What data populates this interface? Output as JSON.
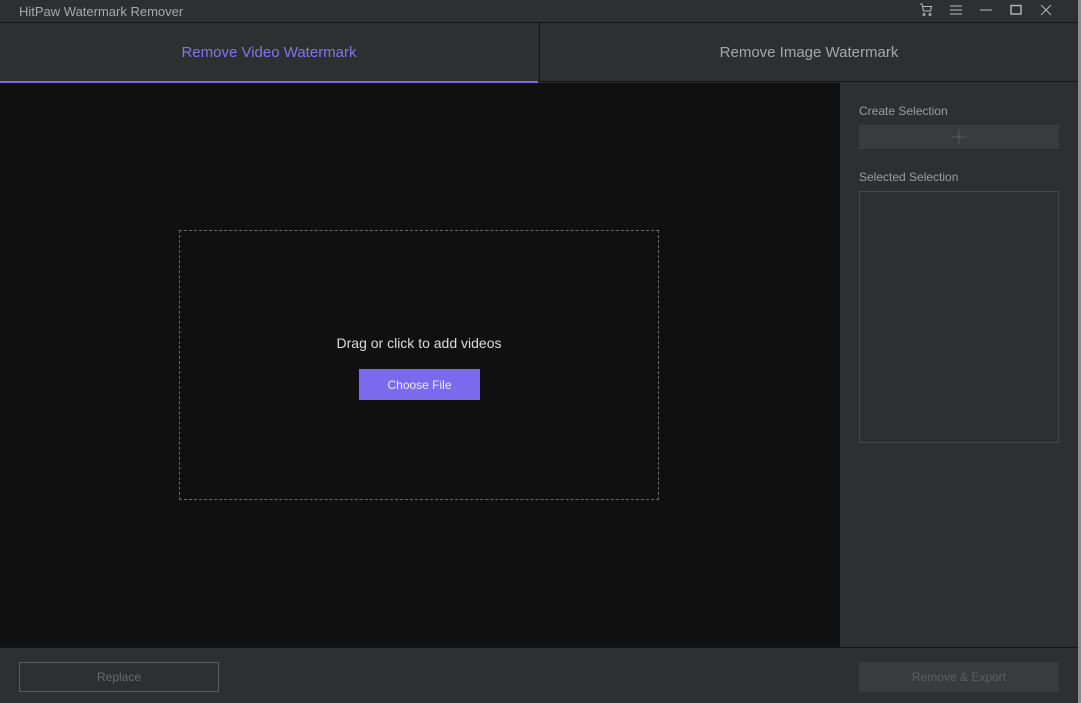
{
  "window": {
    "title": "HitPaw Watermark Remover",
    "controls": [
      {
        "name": "cart-icon",
        "label": "Store"
      },
      {
        "name": "menu-icon",
        "label": "Menu"
      },
      {
        "name": "minimize-icon",
        "label": "Minimize"
      },
      {
        "name": "maximize-icon",
        "label": "Maximize"
      },
      {
        "name": "close-icon",
        "label": "Close"
      }
    ]
  },
  "tabs": [
    {
      "label": "Remove Video Watermark",
      "active": true
    },
    {
      "label": "Remove Image Watermark",
      "active": false
    }
  ],
  "dropzone": {
    "prompt": "Drag or click to add videos",
    "button_label": "Choose File"
  },
  "side_panel": {
    "create_label": "Create Selection",
    "create_button_icon": "plus-icon",
    "selected_label": "Selected Selection",
    "selections": []
  },
  "footer": {
    "replace_label": "Replace",
    "export_label": "Remove & Export"
  },
  "colors": {
    "accent": "#7b69ee",
    "active_tab_text": "#8673ec",
    "background": "#2e2f31",
    "canvas": "#101010"
  }
}
